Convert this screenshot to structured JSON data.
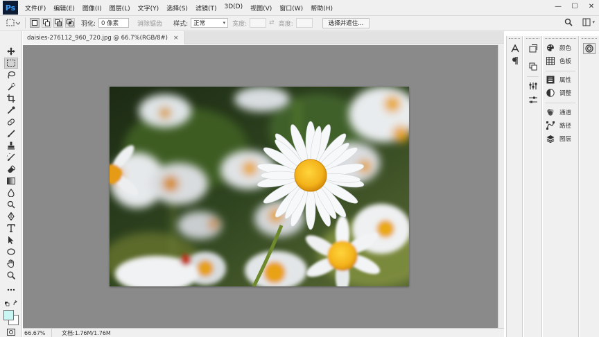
{
  "app": {
    "logo": "Ps",
    "menus": [
      "文件(F)",
      "编辑(E)",
      "图像(I)",
      "图层(L)",
      "文字(Y)",
      "选择(S)",
      "滤镜(T)",
      "3D(D)",
      "视图(V)",
      "窗口(W)",
      "帮助(H)"
    ],
    "window_controls": {
      "minimize": "—",
      "maximize": "☐",
      "close": "✕"
    }
  },
  "options": {
    "feather_label": "羽化:",
    "feather_value": "0 像素",
    "antialias_label": "消除锯齿",
    "style_label": "样式:",
    "style_value": "正常",
    "width_label": "宽度:",
    "height_label": "高度:",
    "select_mask_button": "选择并遮住..."
  },
  "document": {
    "tab_title": "daisies-276112_960_720.jpg @ 66.7%(RGB/8#)",
    "tab_close": "×"
  },
  "status": {
    "zoom": "66.67%",
    "doc_size": "文档:1.76M/1.76M"
  },
  "panels": {
    "items": [
      {
        "label": "颜色",
        "icon": "palette-icon"
      },
      {
        "label": "色板",
        "icon": "swatches-grid-icon"
      },
      {
        "label": "属性",
        "icon": "properties-icon"
      },
      {
        "label": "调整",
        "icon": "adjustments-icon"
      },
      {
        "label": "通道",
        "icon": "channels-icon"
      },
      {
        "label": "路径",
        "icon": "paths-icon"
      },
      {
        "label": "图层",
        "icon": "layers-icon"
      }
    ]
  },
  "colors": {
    "foreground": "#c9f5f2",
    "background": "#ffffff",
    "canvas_bg": "#8a8a8a",
    "ui_bg": "#f0f0f0"
  }
}
